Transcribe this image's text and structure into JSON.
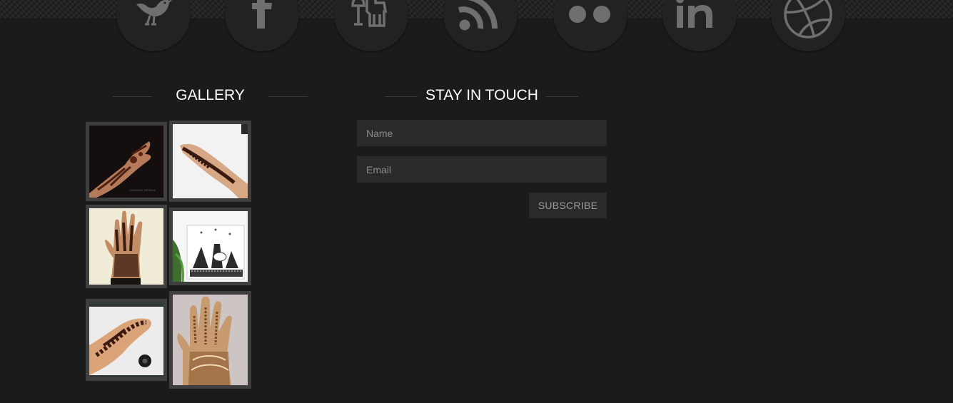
{
  "social": [
    {
      "icon": "twitter-bird-icon"
    },
    {
      "icon": "facebook-icon"
    },
    {
      "icon": "myspace-icon"
    },
    {
      "icon": "rss-icon"
    },
    {
      "icon": "flickr-icon"
    },
    {
      "icon": "linkedin-icon"
    },
    {
      "icon": "dribbble-icon"
    }
  ],
  "gallery": {
    "title": "GALLERY",
    "images": [
      {
        "description": "henna hand on dark background",
        "watermark": "JANNAH HENNA"
      },
      {
        "description": "henna hand on white background"
      },
      {
        "description": "henna palm on cream background"
      },
      {
        "description": "henna card with cityscape drawing"
      },
      {
        "description": "henna hand photo print"
      },
      {
        "description": "henna palm with gold pattern"
      }
    ]
  },
  "newsletter": {
    "title": "STAY IN TOUCH",
    "name_placeholder": "Name",
    "email_placeholder": "Email",
    "subscribe_label": "SUBSCRIBE"
  },
  "colors": {
    "background": "#1b1b1c",
    "social_circle": "#222223",
    "icon": "#6f6f70",
    "field_bg": "#2a2a2b",
    "heading": "#ffffff"
  }
}
